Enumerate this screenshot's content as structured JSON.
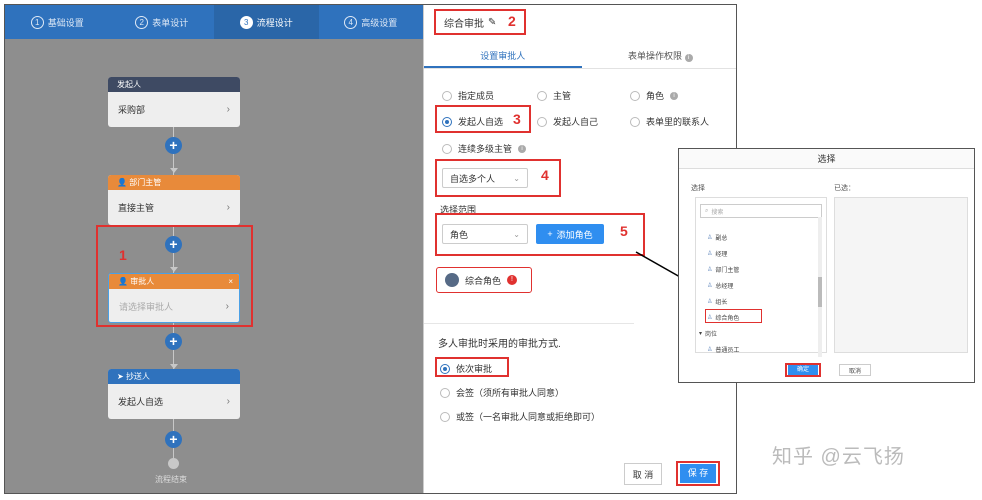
{
  "steps": [
    {
      "num": "1",
      "label": "基础设置"
    },
    {
      "num": "2",
      "label": "表单设计"
    },
    {
      "num": "3",
      "label": "流程设计"
    },
    {
      "num": "4",
      "label": "高级设置"
    }
  ],
  "flow": {
    "initiator": {
      "head": "发起人",
      "body": "采购部"
    },
    "dept": {
      "head": "部门主管",
      "body": "直接主管"
    },
    "approver": {
      "head": "审批人",
      "body": "请选择审批人"
    },
    "cc": {
      "head": "抄送人",
      "body": "发起人自选"
    },
    "end_label": "流程结束"
  },
  "annotations": [
    "1",
    "2",
    "3",
    "4",
    "5"
  ],
  "panel": {
    "title": "综合审批",
    "tabs": [
      "设置审批人",
      "表单操作权限"
    ],
    "options": {
      "assign_member": "指定成员",
      "supervisor": "主管",
      "role": "角色",
      "self_select": "发起人自选",
      "self": "发起人自己",
      "form_contact": "表单里的联系人",
      "multi_supervisor": "连续多级主管"
    },
    "multi_select": "自选多个人",
    "scope_label": "选择范围",
    "scope_select": "角色",
    "add_role": "添加角色",
    "role_chip": "综合角色",
    "approval_mode_title": "多人审批时采用的审批方式.",
    "modes": [
      "依次审批",
      "会签（须所有审批人同意）",
      "或签（一名审批人同意或拒绝即可）"
    ],
    "cancel": "取 消",
    "save": "保 存"
  },
  "dialog": {
    "title": "选择",
    "left_label": "选择",
    "right_label": "已选：",
    "search_placeholder": "搜索",
    "items": [
      "副总",
      "经理",
      "部门主管",
      "总经理",
      "组长",
      "综合角色"
    ],
    "group": "岗位",
    "group_item": "普通员工",
    "ok": "确定",
    "cancel": "取消"
  },
  "watermark": "知乎 @云飞扬",
  "colors": {
    "primary": "#2f72bd",
    "button": "#2f8ef0",
    "highlight": "#e0312f",
    "orange": "#e88a3a"
  }
}
